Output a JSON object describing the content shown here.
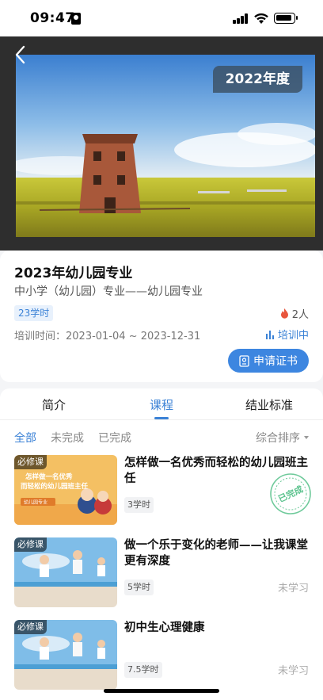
{
  "status_bar": {
    "time": "09:47"
  },
  "hero": {
    "year_badge": "2022年度"
  },
  "course": {
    "title": "2023年幼儿园专业",
    "subtitle": "中小学（幼儿园）专业——幼儿园专业",
    "hours_tag": "23学时",
    "people": "2人",
    "train_time": "培训时间：2023-01-04 ~ 2023-12-31",
    "train_status": "培训中",
    "cert_button": "申请证书"
  },
  "tabs": [
    "简介",
    "课程",
    "结业标准"
  ],
  "active_tab": "课程",
  "filters": [
    "全部",
    "未完成",
    "已完成"
  ],
  "sort_label": "综合排序",
  "course_list": [
    {
      "tag": "必修课",
      "title": "怎样做一名优秀而轻松的幼儿园班主任",
      "hours": "3学时",
      "status": "",
      "stamp": "已完成",
      "thumb_text_1": "怎样做一名优秀",
      "thumb_text_2": "而轻松的幼儿园班主任",
      "thumb_badge": "幼儿园专业"
    },
    {
      "tag": "必修课",
      "title": "做一个乐于变化的老师——让我课堂更有深度",
      "hours": "5学时",
      "status": "未学习"
    },
    {
      "tag": "必修课",
      "title": "初中生心理健康",
      "hours": "7.5学时",
      "status": "未学习"
    }
  ],
  "colors": {
    "accent": "#3b82d6",
    "stamp": "#3fb87a",
    "hero_bg": "#2e2e2e"
  }
}
